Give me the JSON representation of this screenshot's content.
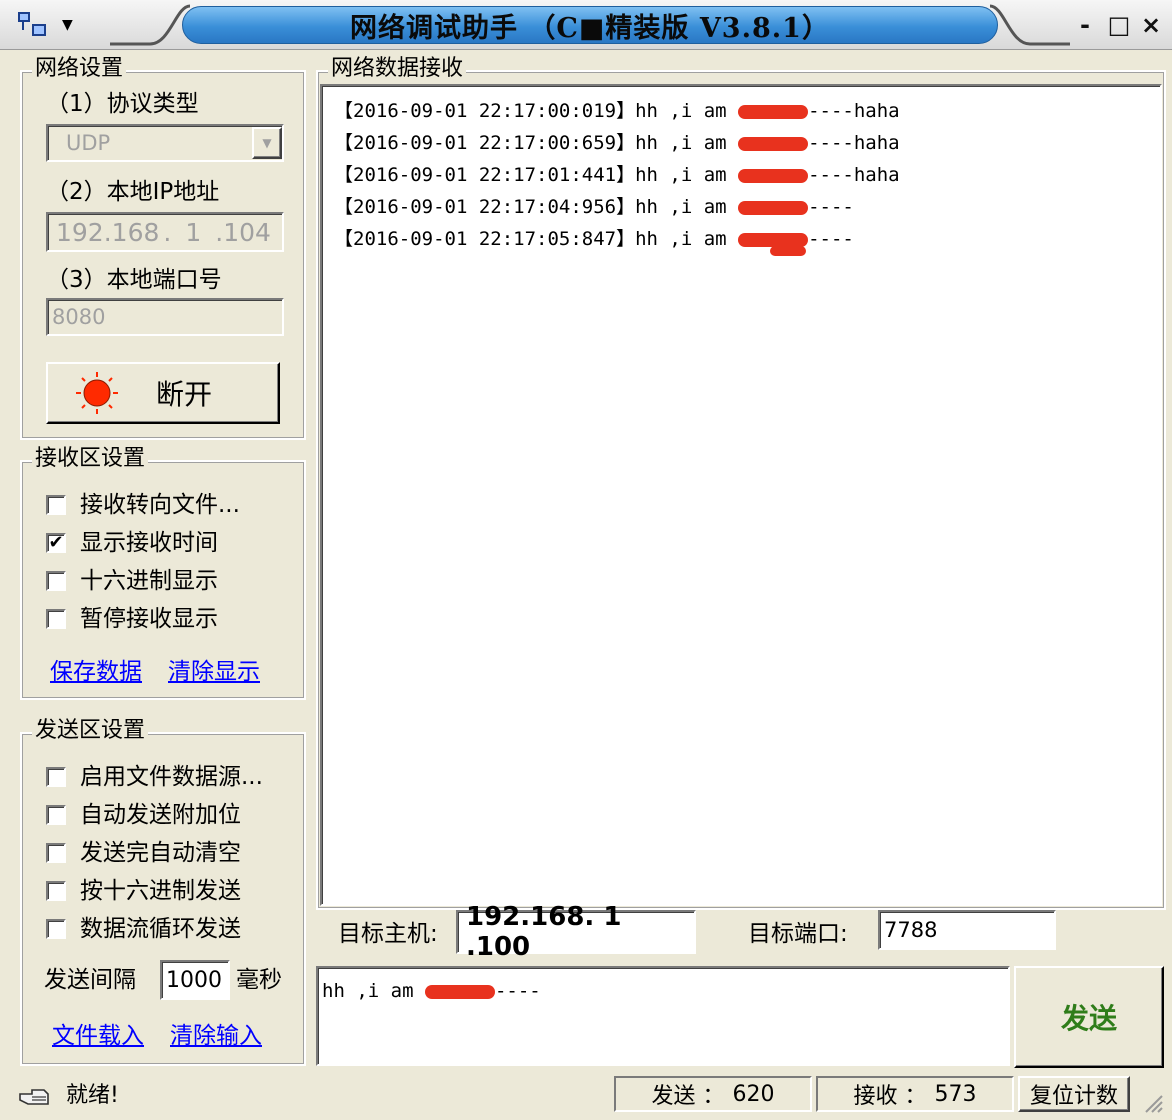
{
  "window": {
    "title": "网络调试助手 （C■精装版 V3.8.1）",
    "min_glyph": "-",
    "max_glyph": "□",
    "close_glyph": "×"
  },
  "network": {
    "group_title": "网络设置",
    "protocol_label": "（1）协议类型",
    "protocol_value": "UDP",
    "ip_label": "（2）本地IP地址",
    "ip_parts": [
      "192",
      "168",
      "1",
      "104"
    ],
    "port_label": "（3）本地端口号",
    "port_value": "8080",
    "connect_button": "断开"
  },
  "receive_settings": {
    "group_title": "接收区设置",
    "options": [
      {
        "label": "接收转向文件...",
        "checked": false
      },
      {
        "label": "显示接收时间",
        "checked": true
      },
      {
        "label": "十六进制显示",
        "checked": false
      },
      {
        "label": "暂停接收显示",
        "checked": false
      }
    ],
    "save_link": "保存数据",
    "clear_link": "清除显示"
  },
  "send_settings": {
    "group_title": "发送区设置",
    "options": [
      {
        "label": "启用文件数据源...",
        "checked": false
      },
      {
        "label": "自动发送附加位",
        "checked": false
      },
      {
        "label": "发送完自动清空",
        "checked": false
      },
      {
        "label": "按十六进制发送",
        "checked": false
      },
      {
        "label": "数据流循环发送",
        "checked": false
      }
    ],
    "interval_label": "发送间隔",
    "interval_value": "1000",
    "interval_unit": "毫秒",
    "load_link": "文件载入",
    "clear_link": "清除输入"
  },
  "receive_area": {
    "group_title": "网络数据接收",
    "lines": [
      {
        "time": "【2016-09-01 22:17:00:019】",
        "msg": "hh ,i am ",
        "tail": "----haha"
      },
      {
        "time": "【2016-09-01 22:17:00:659】",
        "msg": "hh ,i am ",
        "tail": "----haha"
      },
      {
        "time": "【2016-09-01 22:17:01:441】",
        "msg": "hh ,i am ",
        "tail": "----haha"
      },
      {
        "time": "【2016-09-01 22:17:04:956】",
        "msg": "hh ,i am ",
        "tail": "----"
      },
      {
        "time": "【2016-09-01 22:17:05:847】",
        "msg": "hh ,i am ",
        "tail": "----"
      }
    ]
  },
  "target": {
    "host_label": "目标主机:",
    "host_value": "192.168. 1 .100",
    "port_label": "目标端口:",
    "port_value": "7788"
  },
  "send_area": {
    "input_prefix": "hh ,i am ",
    "input_suffix": "----",
    "send_button": "发送"
  },
  "status": {
    "ready_text": "就绪!",
    "sent_label": "发送 ：",
    "sent_count": "620",
    "recv_label": "接收 ：",
    "recv_count": "573",
    "reset_button": "复位计数"
  },
  "colors": {
    "title_gradient": "#3a8fd8",
    "send_button_text": "#2f7d1a",
    "link": "#0000ff",
    "redaction": "#e8321e",
    "connect_indicator": "#ff2a00"
  }
}
